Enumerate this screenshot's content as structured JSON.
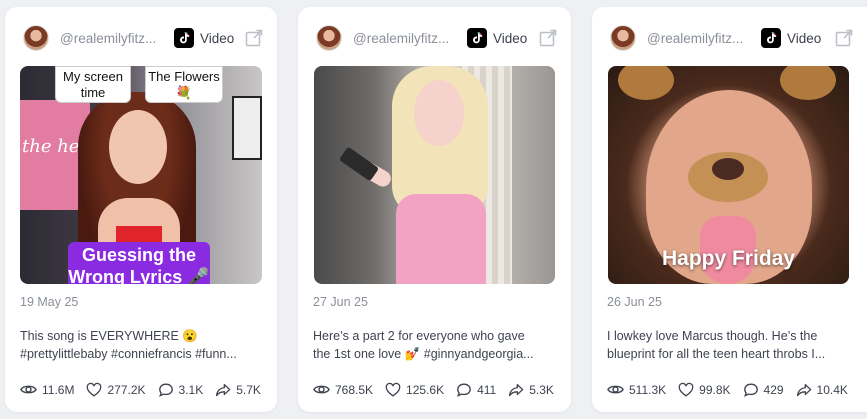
{
  "cards": [
    {
      "handle": "@realemilyfitz...",
      "video_label": "Video",
      "date": "19 May 25",
      "desc_line1": "This song is EVERYWHERE 😮",
      "desc_line2": "#prettylittlebaby #conniefrancis #funn...",
      "overlay_top_left": "My screen time",
      "overlay_top_right": "The Flowers 💐",
      "overlay_caption": "Guessing the Wrong Lyrics 🎤",
      "poster_text": "the hel",
      "views": "11.6M",
      "likes": "277.2K",
      "comments": "3.1K",
      "shares": "5.7K"
    },
    {
      "handle": "@realemilyfitz...",
      "video_label": "Video",
      "date": "27 Jun 25",
      "desc_line1": "Here’s a part 2 for everyone who gave",
      "desc_line2": "the 1st one love 💅 #ginnyandgeorgia...",
      "views": "768.5K",
      "likes": "125.6K",
      "comments": "411",
      "shares": "5.3K"
    },
    {
      "handle": "@realemilyfitz...",
      "video_label": "Video",
      "date": "26 Jun 25",
      "desc_line1": "I lowkey love Marcus though. He’s the",
      "desc_line2": "blueprint for all the teen heart throbs I...",
      "overlay_caption": "Happy Friday",
      "views": "511.3K",
      "likes": "99.8K",
      "comments": "429",
      "shares": "10.4K"
    }
  ],
  "colors": {
    "accent_tiktok": "#000000",
    "text_muted": "#8a8f99",
    "caption_purple": "#8a2be2"
  }
}
